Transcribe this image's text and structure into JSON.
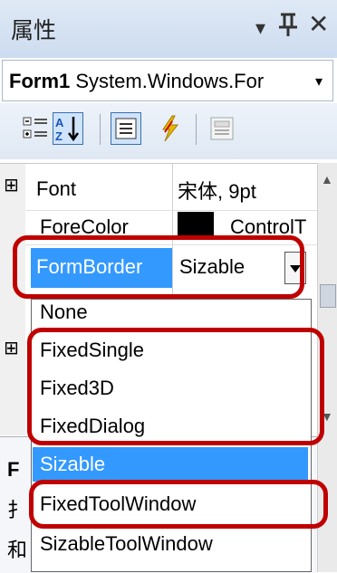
{
  "header": {
    "title": "属性",
    "dropdown_arrow": "▾",
    "pin_glyph": "ᛣ",
    "close_glyph": "✕"
  },
  "object_selector": {
    "name_bold": "Form1",
    "type_text": " System.Windows.For",
    "arrow": "▾"
  },
  "toolbar": {
    "items": [
      "categorized-icon",
      "alphabetical-icon",
      "properties-icon",
      "events-icon",
      "property-pages-icon"
    ]
  },
  "properties": {
    "font_expand": "⊞",
    "font_name": "Font",
    "font_value": "宋体, 9pt",
    "forecolor_name": "ForeColor",
    "forecolor_value": "ControlT",
    "formborder_name": "FormBorder",
    "formborder_value": "Sizable",
    "hidden_expand": "⊞"
  },
  "dropdown": {
    "options": [
      "None",
      "FixedSingle",
      "Fixed3D",
      "FixedDialog",
      "Sizable",
      "FixedToolWindow",
      "SizableToolWindow"
    ],
    "selected": "Sizable"
  },
  "description": {
    "line1": "F",
    "line2": "扌",
    "line3": "和"
  },
  "colors": {
    "selection": "#3399ff",
    "annotation": "#c00000",
    "forecolor_swatch": "#000000"
  }
}
